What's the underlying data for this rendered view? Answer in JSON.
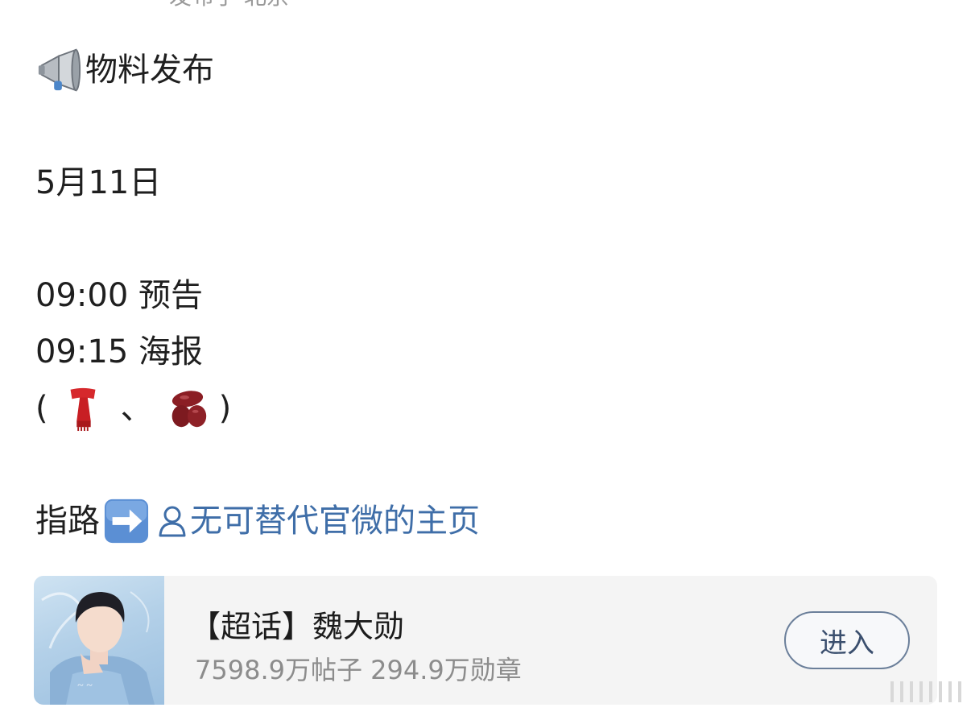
{
  "post": {
    "header_cut": "发布于 北京",
    "title_text": "物料发布",
    "date": "5月11日",
    "schedule": [
      {
        "time": "09:00",
        "item": "预告"
      },
      {
        "time": "09:15",
        "item": "海报"
      }
    ],
    "paren_open": "(",
    "paren_sep": "、",
    "paren_close": ")",
    "guide_label": "指路",
    "link_text": "无可替代官微的主页"
  },
  "card": {
    "title": "【超话】魏大勋",
    "stats": "7598.9万帖子 294.9万勋章",
    "enter_label": "进入"
  },
  "icons": {
    "megaphone": "megaphone-icon",
    "scarf": "scarf-icon",
    "beans": "beans-icon",
    "arrow": "right-arrow-icon",
    "user": "user-icon"
  },
  "colors": {
    "link": "#3f6ea8",
    "text": "#1f1f1f",
    "muted": "#8c8c8c",
    "card_bg": "#f4f4f4"
  }
}
